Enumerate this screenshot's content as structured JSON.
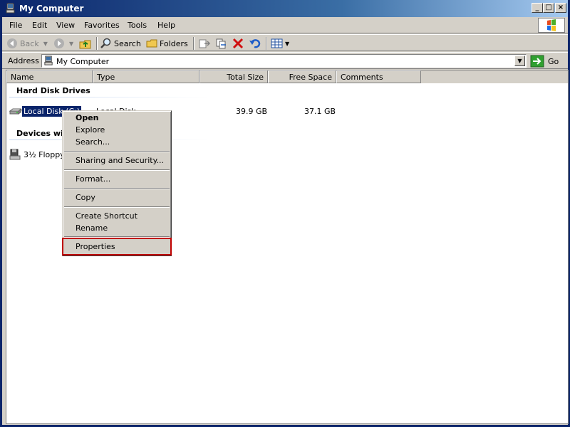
{
  "window": {
    "title": "My Computer"
  },
  "menubar": {
    "items": [
      "File",
      "Edit",
      "View",
      "Favorites",
      "Tools",
      "Help"
    ]
  },
  "toolbar": {
    "back": "Back",
    "search": "Search",
    "folders": "Folders"
  },
  "addressbar": {
    "label": "Address",
    "value": "My Computer",
    "go": "Go"
  },
  "columns": [
    "Name",
    "Type",
    "Total Size",
    "Free Space",
    "Comments"
  ],
  "groups": {
    "hard_disk": "Hard Disk Drives",
    "removable": "Devices wit"
  },
  "rows": {
    "local_disk": {
      "name": "Local Disk (C:)",
      "type": "Local Disk",
      "total": "39.9 GB",
      "free": "37.1 GB"
    },
    "floppy": {
      "name": "3½ Floppy"
    }
  },
  "context_menu": {
    "open": "Open",
    "explore": "Explore",
    "search": "Search...",
    "sharing": "Sharing and Security...",
    "format": "Format...",
    "copy": "Copy",
    "create_shortcut": "Create Shortcut",
    "rename": "Rename",
    "properties": "Properties"
  },
  "colors": {
    "title_active": "#0a246a",
    "selection": "#0a246a",
    "highlight_box": "#c00000",
    "face": "#d4d0c8"
  }
}
